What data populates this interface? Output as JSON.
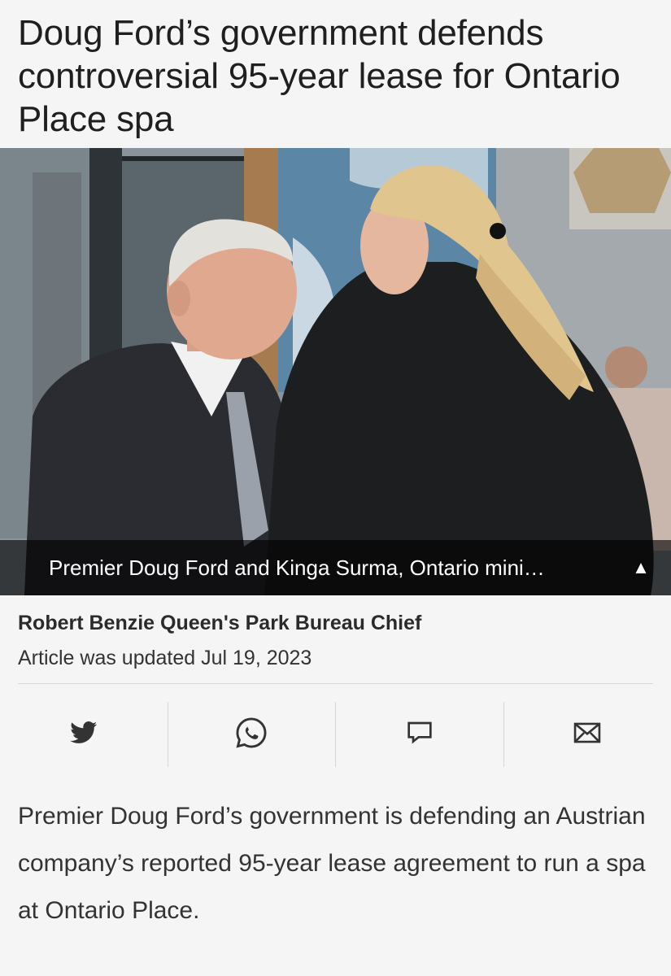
{
  "article": {
    "headline": "Doug Ford’s government defends controversial 95-year lease for Ontario Place spa",
    "photo_caption": "Premier Doug Ford and Kinga Surma, Ontario mini…",
    "caption_toggle": "▲",
    "author": "Robert Benzie Queen's Park Bureau Chief",
    "updated": "Article was updated Jul 19, 2023",
    "paragraph": "Premier Doug Ford’s government is defending an Austrian company’s reported 95-year lease agreement to run a spa at Ontario Place."
  },
  "share": {
    "icons": [
      "twitter-icon",
      "whatsapp-icon",
      "comment-icon",
      "email-icon"
    ],
    "icon_color": "#333333"
  }
}
